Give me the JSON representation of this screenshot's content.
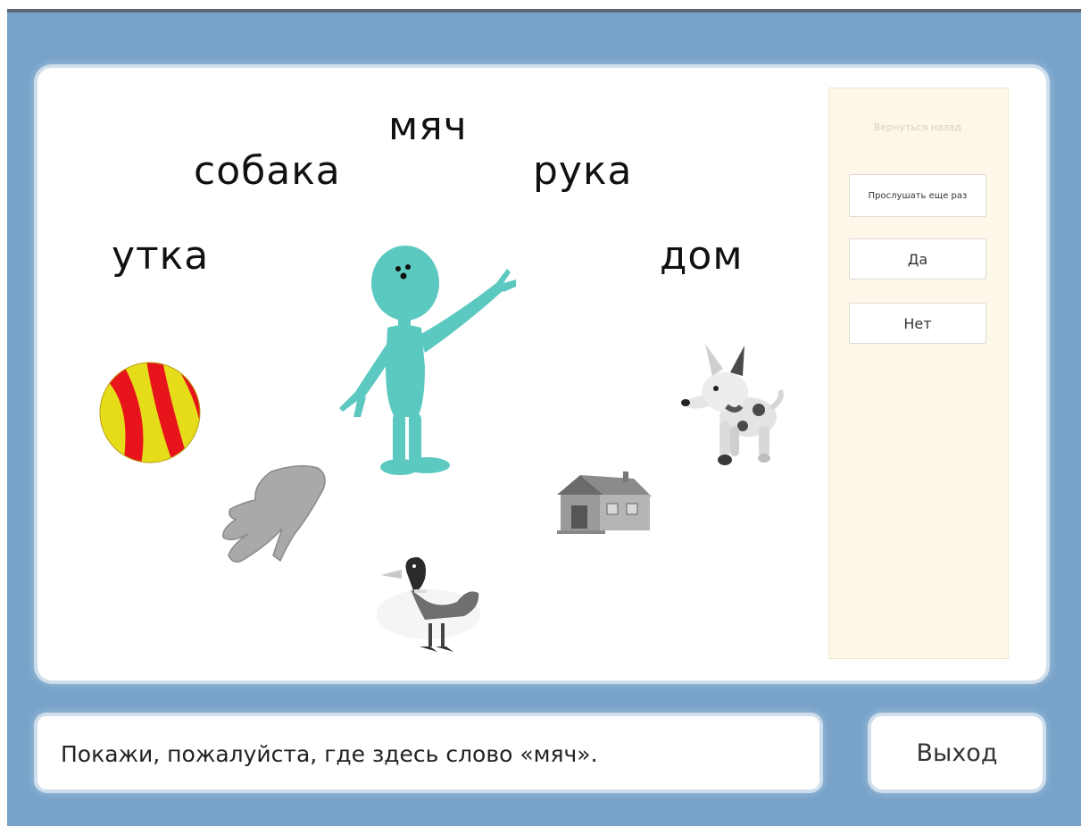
{
  "words": {
    "ball": "мяч",
    "dog": "собака",
    "hand": "рука",
    "duck": "утка",
    "house": "дом"
  },
  "sidebar": {
    "back": "Вернуться назад",
    "replay": "Прослушать еще раз",
    "yes": "Да",
    "no": "Нет"
  },
  "prompt": "Покажи, пожалуйста, где здесь слово «мяч».",
  "exit": "Выход",
  "colors": {
    "background": "#77a2c9",
    "sidebar": "#fdf8ea",
    "character": "#5cc9c0",
    "ball_red": "#e8141c",
    "ball_yellow": "#e6dd1a"
  }
}
